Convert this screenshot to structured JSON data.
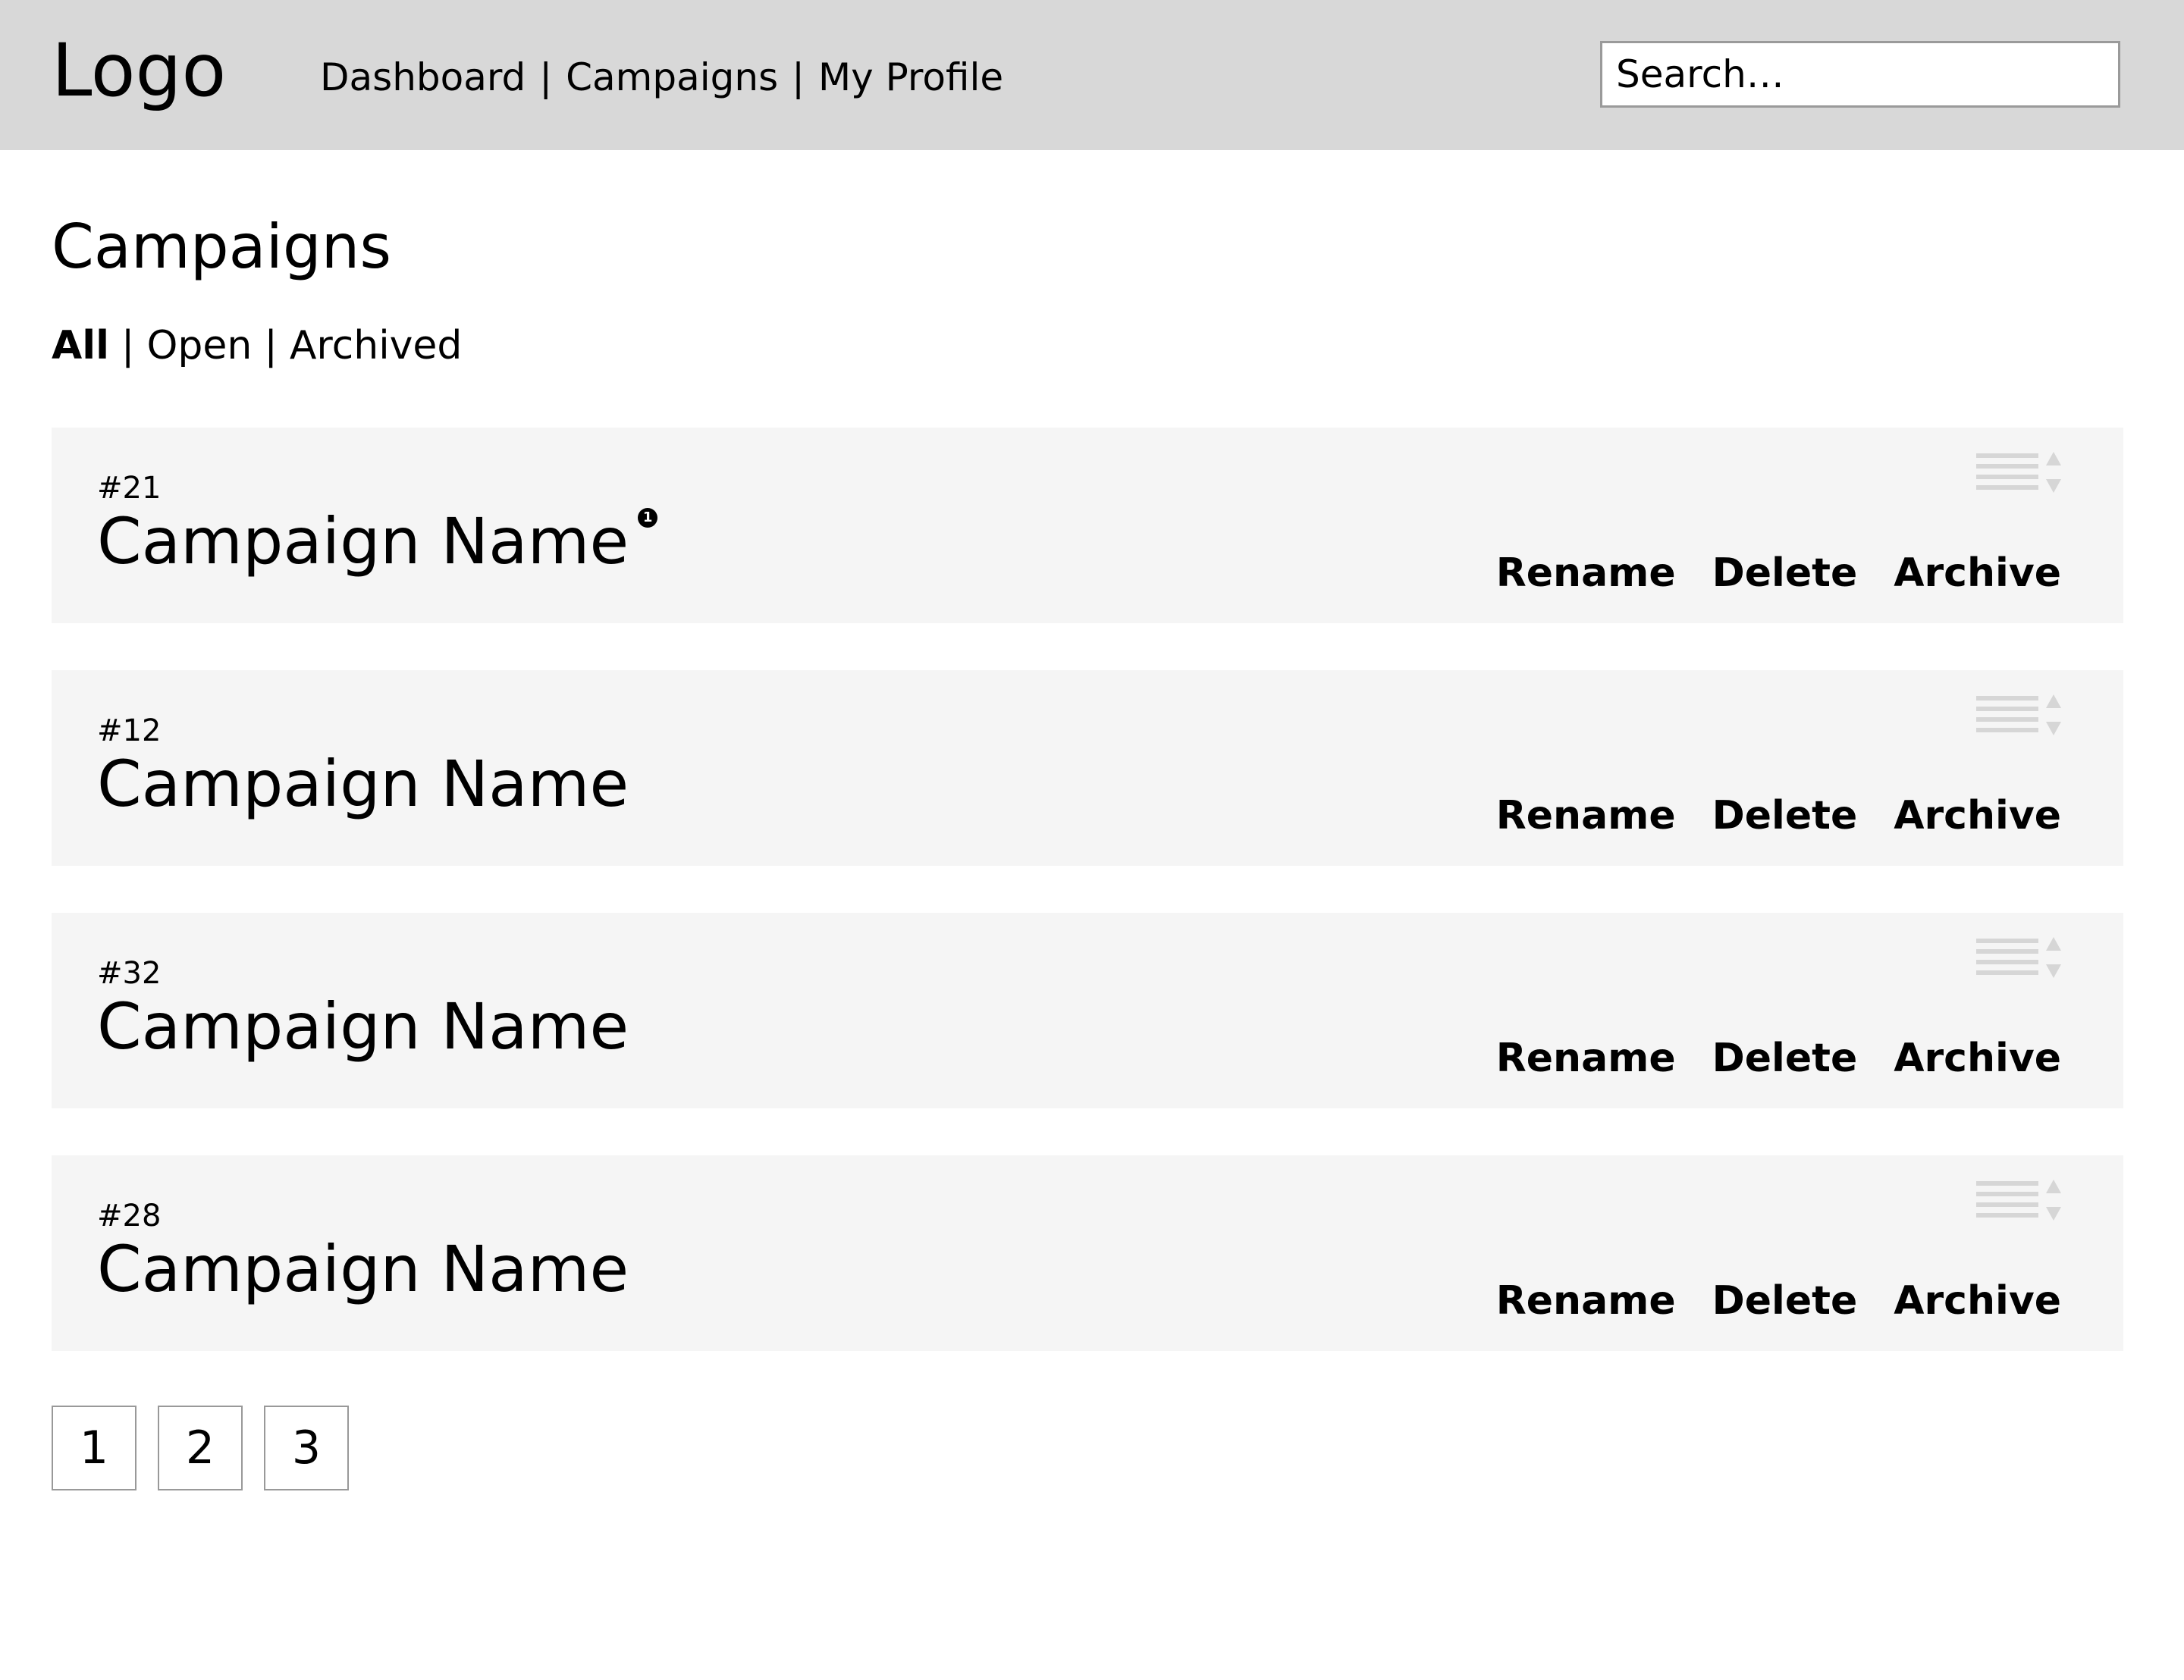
{
  "header": {
    "logo": "Logo",
    "nav": [
      {
        "label": "Dashboard"
      },
      {
        "label": "Campaigns"
      },
      {
        "label": "My Profile"
      }
    ],
    "separator": "|",
    "search_placeholder": "Search…"
  },
  "main": {
    "title": "Campaigns",
    "filters": [
      {
        "label": "All",
        "active": true
      },
      {
        "label": "Open",
        "active": false
      },
      {
        "label": "Archived",
        "active": false
      }
    ],
    "filter_separator": "|",
    "campaigns": [
      {
        "id": "#21",
        "name": "Campaign Name",
        "badge": "1"
      },
      {
        "id": "#12",
        "name": "Campaign Name"
      },
      {
        "id": "#32",
        "name": "Campaign Name"
      },
      {
        "id": "#28",
        "name": "Campaign Name"
      }
    ],
    "actions": {
      "rename": "Rename",
      "delete": "Delete",
      "archive": "Archive"
    }
  },
  "pagination": {
    "pages": [
      "1",
      "2",
      "3"
    ]
  },
  "colors": {
    "header_bg": "#d8d8d8",
    "card_bg": "#f5f5f5",
    "handle_gray": "#d6d6d6"
  },
  "icons": {
    "drag_handle": "drag-handle-icon",
    "sort": "sort-arrows-icon",
    "notification": "notification-badge"
  }
}
